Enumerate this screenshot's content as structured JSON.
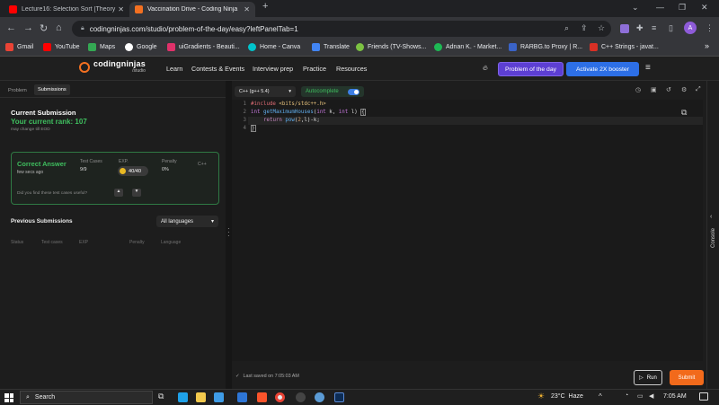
{
  "browser": {
    "tabs": [
      {
        "title": "Lecture16: Selection Sort [Theory",
        "active": false,
        "favicon_color": "#ff0000"
      },
      {
        "title": "Vaccination Drive - Coding Ninja",
        "active": true,
        "favicon_color": "#f37021"
      }
    ],
    "url": "codingninjas.com/studio/problem-of-the-day/easy?leftPanelTab=1",
    "profile_initial": "A",
    "bookmarks": [
      "Gmail",
      "YouTube",
      "Maps",
      "Google",
      "uiGradients - Beauti...",
      "Home - Canva",
      "Translate",
      "Friends (TV-Shows...",
      "Adnan K. - Market...",
      "RARBG.to Proxy | R...",
      "C++ Strings - javat..."
    ]
  },
  "site": {
    "brand": "codingninjas",
    "brand_sub": "/studio",
    "nav": [
      "Learn",
      "Contests & Events",
      "Interview prep",
      "Practice",
      "Resources"
    ],
    "potd_label": "Problem of the day",
    "boost_label": "Activate 2X booster"
  },
  "left_panel": {
    "tabs": [
      "Problem",
      "Submissions"
    ],
    "current_heading": "Current Submission",
    "rank_text": "Your current rank: 107",
    "rank_note": "may change till EOD",
    "result": {
      "status": "Correct Answer",
      "time": "few secs ago",
      "test_cases_label": "Test Cases",
      "test_cases_value": "9/9",
      "exp_label": "EXP.",
      "exp_value": "40/40",
      "penalty_label": "Penalty",
      "penalty_value": "0%",
      "language": "C++",
      "feedback_q": "Did you find these test cases useful?"
    },
    "previous_heading": "Previous Submissions",
    "language_filter": "All languages",
    "columns": [
      "Status",
      "Test cases",
      "EXP",
      "Penalty",
      "Language"
    ]
  },
  "editor": {
    "language_select": "C++ (g++ 5.4)",
    "autocomplete_label": "Autocomplete",
    "autocomplete_on": true,
    "lines": [
      {
        "n": "1",
        "text": "#include <bits/stdc++.h>"
      },
      {
        "n": "2",
        "text": "int getMaximumHouses(int k, int l) {"
      },
      {
        "n": "3",
        "text": "    return pow(2,l)-k;"
      },
      {
        "n": "4",
        "text": "}"
      }
    ],
    "last_saved": "Last saved on 7:05:03 AM",
    "run_label": "Run",
    "submit_label": "Submit",
    "console_label": "Console"
  },
  "taskbar": {
    "search_placeholder": "Search",
    "weather": "23°C  Haze",
    "time": "7:05 AM"
  }
}
